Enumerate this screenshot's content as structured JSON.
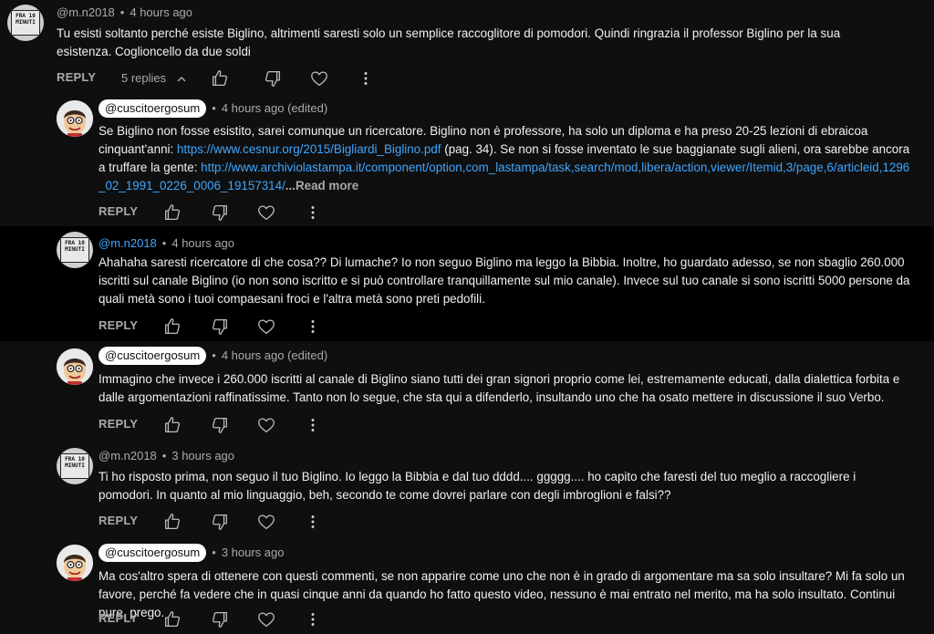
{
  "actions": {
    "reply_label": "REPLY"
  },
  "comments": [
    {
      "author": "@m.n2018",
      "time": "4 hours ago",
      "avatar_sign": [
        "FRA 10",
        "MINUTI"
      ],
      "text": "Tu esisti soltanto perché esiste Biglino, altrimenti saresti solo un semplice raccoglitore di pomodori. Quindi ringrazia il professor Biglino per la sua esistenza. Coglioncello da due soldi",
      "replies_label": "5 replies"
    },
    {
      "author": "@cuscitoergosum",
      "time": "4 hours ago (edited)",
      "text_part1": "Se Biglino non fosse esistito, sarei comunque un ricercatore. Biglino non è professore, ha solo un diploma e ha preso 20-25 lezioni di ebraicoa cinquant'anni: ",
      "link1": "https://www.cesnur.org/2015/Bigliardi_Biglino.pdf",
      "text_part2": " (pag. 34). Se non si fosse inventato le sue baggianate sugli alieni, ora sarebbe ancora a truffare la gente: ",
      "link2": "http://www.archiviolastampa.it/component/option,com_lastampa/task,search/mod,libera/action,viewer/Itemid,3/page,6/articleid,1296_02_1991_0226_0006_19157314/",
      "read_more": "...Read more"
    },
    {
      "author": "@m.n2018",
      "time": "4 hours ago",
      "avatar_sign": [
        "FRA 10",
        "MINUTI"
      ],
      "text": "Ahahaha saresti ricercatore di che cosa?? Di lumache? Io non seguo Biglino ma leggo la Bibbia. Inoltre, ho guardato adesso, se non sbaglio 260.000 iscritti sul canale Biglino (io non sono iscritto e si può controllare tranquillamente sul mio canale).  Invece sul tuo canale si sono iscritti 5000 persone da quali metà sono i tuoi compaesani froci e l'altra metà sono preti pedofili."
    },
    {
      "author": "@cuscitoergosum",
      "time": "4 hours ago (edited)",
      "text": "Immagino che invece i 260.000 iscritti al canale di Biglino siano tutti dei gran signori proprio come lei, estremamente educati, dalla dialettica forbita e dalle argomentazioni raffinatissime. Tanto non lo segue, che sta qui a difenderlo, insultando uno che ha osato mettere in discussione il suo Verbo."
    },
    {
      "author": "@m.n2018",
      "time": "3 hours ago",
      "avatar_sign": [
        "FRA 10",
        "MINUTI"
      ],
      "text": "Ti ho risposto prima, non seguo il tuo Biglino. Io leggo la Bibbia e dal tuo dddd.... ggggg.... ho capito che faresti del tuo meglio a raccogliere i pomodori. In quanto al mio linguaggio, beh, secondo te come dovrei parlare con degli imbroglioni e falsi??"
    },
    {
      "author": "@cuscitoergosum",
      "time": "3 hours ago",
      "text": "Ma cos'altro spera di ottenere con questi commenti, se non apparire come uno che non è in grado di argomentare ma sa solo insultare? Mi fa solo un favore, perché fa vedere che in quasi cinque anni da quando ho fatto questo video, nessuno è mai entrato nel merito, ma ha solo insultato. Continui pure, prego."
    }
  ],
  "icons": {
    "like": "thumb-up-icon",
    "dislike": "thumb-down-icon",
    "heart": "heart-icon",
    "more": "more-vert-icon",
    "collapse": "chevron-up-icon"
  },
  "colors": {
    "background": "#0f0f0f",
    "highlight_row": "#000000",
    "link": "#3ea6ff",
    "muted": "#aaaaaa"
  }
}
